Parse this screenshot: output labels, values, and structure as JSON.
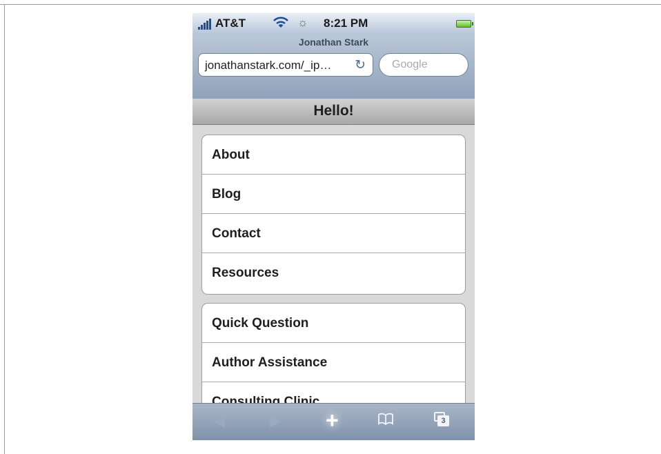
{
  "status": {
    "carrier": "AT&T",
    "time": "8:21 PM"
  },
  "browser": {
    "page_title": "Jonathan Stark",
    "url": "jonathanstark.com/_ip…",
    "search_placeholder": "Google"
  },
  "app": {
    "title": "Hello!",
    "list1": [
      "About",
      "Blog",
      "Contact",
      "Resources"
    ],
    "list2": [
      "Quick Question",
      "Author Assistance",
      "Consulting Clinic"
    ]
  },
  "toolbar": {
    "pages_count": "3"
  },
  "icons": {
    "wifi": "wifi-icon",
    "spinner": "loading-icon",
    "reload": "reload-icon",
    "back": "back-arrow-icon",
    "forward": "forward-arrow-icon",
    "add": "add-icon",
    "bookmarks": "bookmarks-icon",
    "pages": "pages-icon"
  },
  "colors": {
    "accent": "#1a4e9a",
    "battery": "#5fc22b"
  }
}
